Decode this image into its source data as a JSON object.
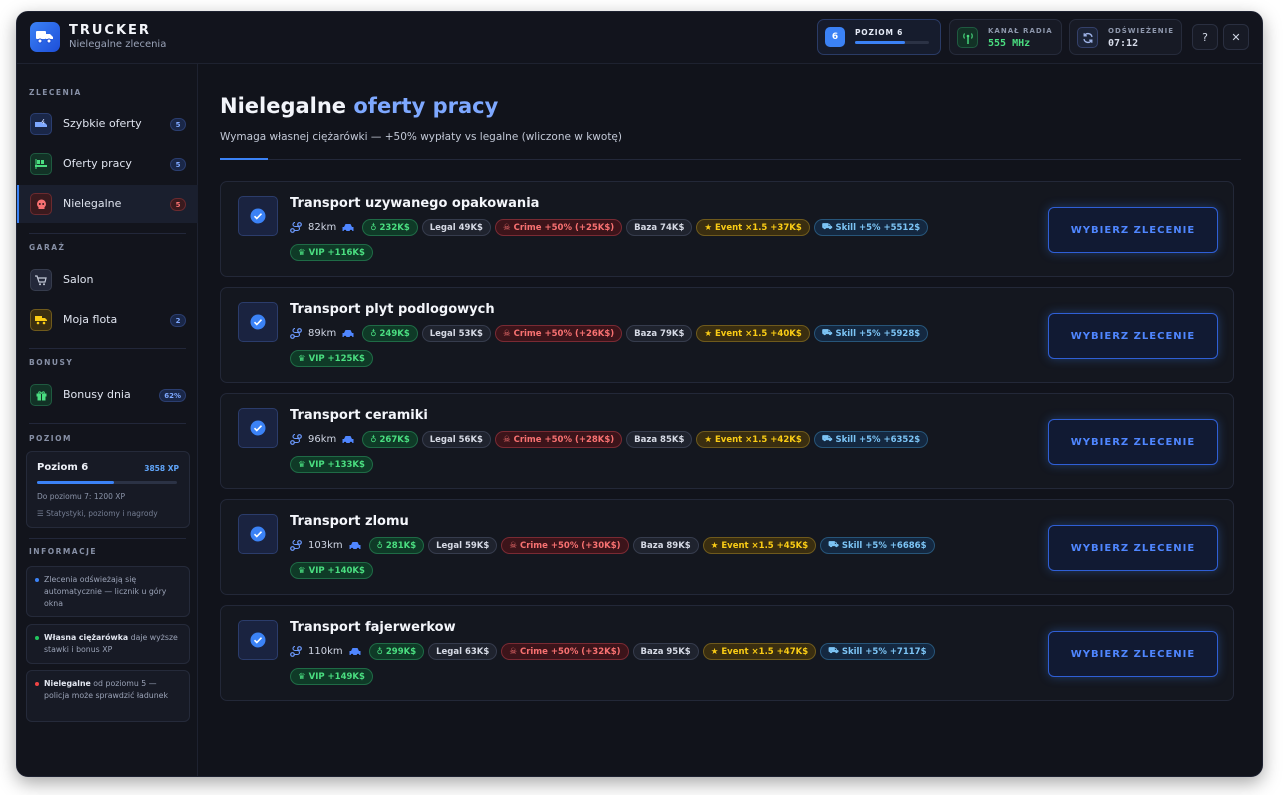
{
  "header": {
    "title": "TRUCKER",
    "subtitle": "Nielegalne zlecenia",
    "level": {
      "badge": "6",
      "label": "POZIOM 6",
      "progress": 0.68
    },
    "radio": {
      "label": "KANAŁ RADIA",
      "value": "555 MHz"
    },
    "refresh": {
      "label": "ODŚWIEŻENIE",
      "value": "07:12"
    },
    "help": "?",
    "close": "✕"
  },
  "sidebar": {
    "sections": {
      "orders": "ZLECENIA",
      "garage": "GARAŻ",
      "bonuses": "BONUSY",
      "level": "POZIOM",
      "info": "INFORMACJE"
    },
    "items": [
      {
        "label": "Szybkie oferty",
        "count": "5"
      },
      {
        "label": "Oferty pracy",
        "count": "5"
      },
      {
        "label": "Nielegalne",
        "count": "5"
      },
      {
        "label": "Salon"
      },
      {
        "label": "Moja flota",
        "count": "2"
      },
      {
        "label": "Bonusy dnia",
        "count": "62%"
      }
    ],
    "level_card": {
      "title": "Poziom 6",
      "xp": "3858 XP",
      "progress": 0.55,
      "next": "Do poziomu 7: 1200 XP",
      "link": "Statystyki, poziomy i nagrody"
    },
    "info": [
      {
        "bold": "",
        "text": "Zlecenia odświeżają się automatycznie — licznik u góry okna",
        "color": "#3b82f6"
      },
      {
        "bold": "Własna ciężarówka",
        "text": " daje wyższe stawki i bonus XP",
        "color": "#22c55e"
      },
      {
        "bold": "Nielegalne",
        "text": " od poziomu 5 — policja może sprawdzić ładunek",
        "color": "#ef4444"
      }
    ]
  },
  "main": {
    "title_plain": "Nielegalne",
    "title_accent": "oferty pracy",
    "subtitle": "Wymaga własnej ciężarówki — +50% wypłaty vs legalne (wliczone w kwotę)",
    "jobs": [
      {
        "title": "Transport uzywanego opakowania",
        "km": "82km",
        "pay": "232K$",
        "legal": "Legal 49K$",
        "crime": "Crime +50% (+25K$)",
        "base": "Baza 74K$",
        "event": "Event ×1.5 +37K$",
        "skill": "Skill +5% +5512$",
        "vip": "VIP +116K$",
        "button": "WYBIERZ ZLECENIE"
      },
      {
        "title": "Transport plyt podlogowych",
        "km": "89km",
        "pay": "249K$",
        "legal": "Legal 53K$",
        "crime": "Crime +50% (+26K$)",
        "base": "Baza 79K$",
        "event": "Event ×1.5 +40K$",
        "skill": "Skill +5% +5928$",
        "vip": "VIP +125K$",
        "button": "WYBIERZ ZLECENIE"
      },
      {
        "title": "Transport ceramiki",
        "km": "96km",
        "pay": "267K$",
        "legal": "Legal 56K$",
        "crime": "Crime +50% (+28K$)",
        "base": "Baza 85K$",
        "event": "Event ×1.5 +42K$",
        "skill": "Skill +5% +6352$",
        "vip": "VIP +133K$",
        "button": "WYBIERZ ZLECENIE"
      },
      {
        "title": "Transport zlomu",
        "km": "103km",
        "pay": "281K$",
        "legal": "Legal 59K$",
        "crime": "Crime +50% (+30K$)",
        "base": "Baza 89K$",
        "event": "Event ×1.5 +45K$",
        "skill": "Skill +5% +6686$",
        "vip": "VIP +140K$",
        "button": "WYBIERZ ZLECENIE"
      },
      {
        "title": "Transport fajerwerkow",
        "km": "110km",
        "pay": "299K$",
        "legal": "Legal 63K$",
        "crime": "Crime +50% (+32K$)",
        "base": "Baza 95K$",
        "event": "Event ×1.5 +47K$",
        "skill": "Skill +5% +7117$",
        "vip": "VIP +149K$",
        "button": "WYBIERZ ZLECENIE"
      }
    ]
  },
  "colors": {
    "accent": "#3b82f6",
    "background": "#11131b",
    "green": "#4ade80",
    "red": "#f87171",
    "yellow": "#facc15"
  }
}
